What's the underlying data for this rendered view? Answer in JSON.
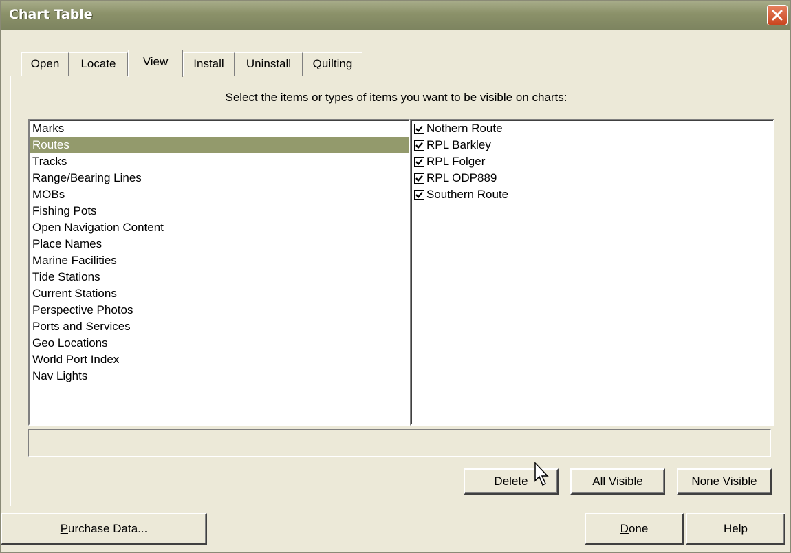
{
  "window": {
    "title": "Chart Table"
  },
  "tabs": [
    {
      "label": "Open",
      "active": false
    },
    {
      "label": "Locate",
      "active": false
    },
    {
      "label": "View",
      "active": true
    },
    {
      "label": "Install",
      "active": false
    },
    {
      "label": "Uninstall",
      "active": false
    },
    {
      "label": "Quilting",
      "active": false
    }
  ],
  "view": {
    "instruction": "Select the items or types of items you want to be visible on charts:",
    "item_types": [
      "Marks",
      "Routes",
      "Tracks",
      "Range/Bearing Lines",
      "MOBs",
      "Fishing Pots",
      "Open Navigation Content",
      "Place Names",
      "Marine Facilities",
      "Tide Stations",
      "Current Stations",
      "Perspective Photos",
      "Ports and Services",
      "Geo Locations",
      "World Port Index",
      "Nav Lights"
    ],
    "selected_type": "Routes",
    "items": [
      {
        "label": "Nothern Route",
        "checked": true
      },
      {
        "label": "RPL Barkley",
        "checked": true
      },
      {
        "label": "RPL Folger",
        "checked": true
      },
      {
        "label": "RPL ODP889",
        "checked": true
      },
      {
        "label": "Southern Route",
        "checked": true
      }
    ],
    "status_text": "",
    "buttons": {
      "delete": {
        "mnemonic": "D",
        "rest": "elete"
      },
      "all_visible": {
        "mnemonic": "A",
        "rest": "ll Visible"
      },
      "none_visible": {
        "mnemonic": "N",
        "rest": "one Visible"
      }
    }
  },
  "footer": {
    "purchase": {
      "mnemonic": "P",
      "rest": "urchase Data..."
    },
    "done": {
      "mnemonic": "D",
      "rest": "one"
    },
    "help": "Help"
  },
  "colors": {
    "titlebar": "#8b9169",
    "selection": "#939a6c",
    "close": "#c9461f",
    "face": "#ECE9D8"
  },
  "icons": {
    "close": "close-x-icon",
    "check": "check-mark-icon",
    "cursor": "mouse-pointer-icon"
  }
}
